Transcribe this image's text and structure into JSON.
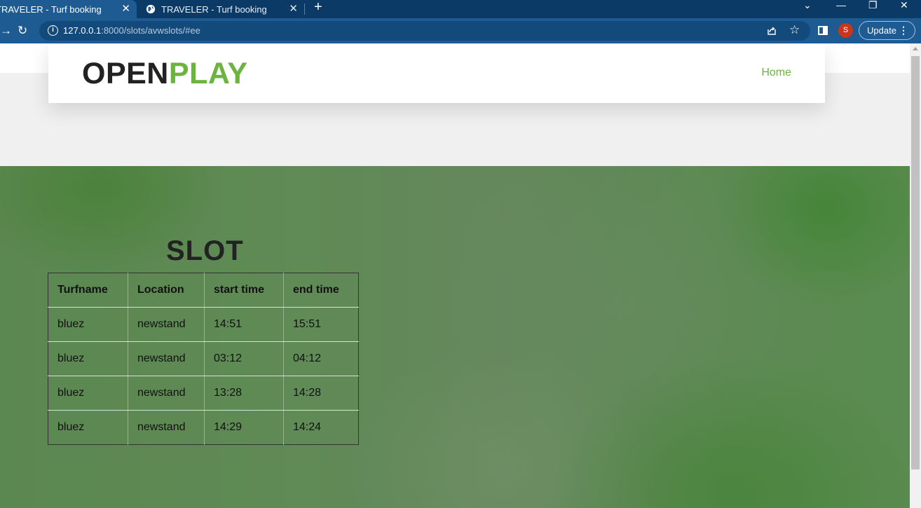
{
  "browser": {
    "tabs": [
      {
        "title": "TRAVELER - Turf booking",
        "active": true
      },
      {
        "title": "TRAVELER - Turf booking",
        "active": false
      }
    ],
    "url_host": "127.0.0.1",
    "url_rest": ":8000/slots/avwslots/#ee",
    "profile_initial": "S",
    "update_label": "Update",
    "icons": [
      "close-icon",
      "globe-icon",
      "new-tab-icon",
      "minimize-icon",
      "restore-icon",
      "back-icon",
      "reload-icon",
      "info-icon",
      "share-icon",
      "star-icon",
      "side-panel-icon",
      "menu-dots-icon"
    ]
  },
  "navbar": {
    "logo_part1": "OPEN",
    "logo_part2": "PLAY",
    "home_label": "Home"
  },
  "colors": {
    "brand_green": "#6db33f",
    "logo_dark": "#222222",
    "chrome_blue": "#1d5b92",
    "profile_red": "#c8361b"
  },
  "slots": {
    "heading": "SLOT",
    "columns": [
      "Turfname",
      "Location",
      "start time",
      "end time"
    ],
    "rows": [
      [
        "bluez",
        "newstand",
        "14:51",
        "15:51"
      ],
      [
        "bluez",
        "newstand",
        "03:12",
        "04:12"
      ],
      [
        "bluez",
        "newstand",
        "13:28",
        "14:28"
      ],
      [
        "bluez",
        "newstand",
        "14:29",
        "14:24"
      ]
    ]
  }
}
